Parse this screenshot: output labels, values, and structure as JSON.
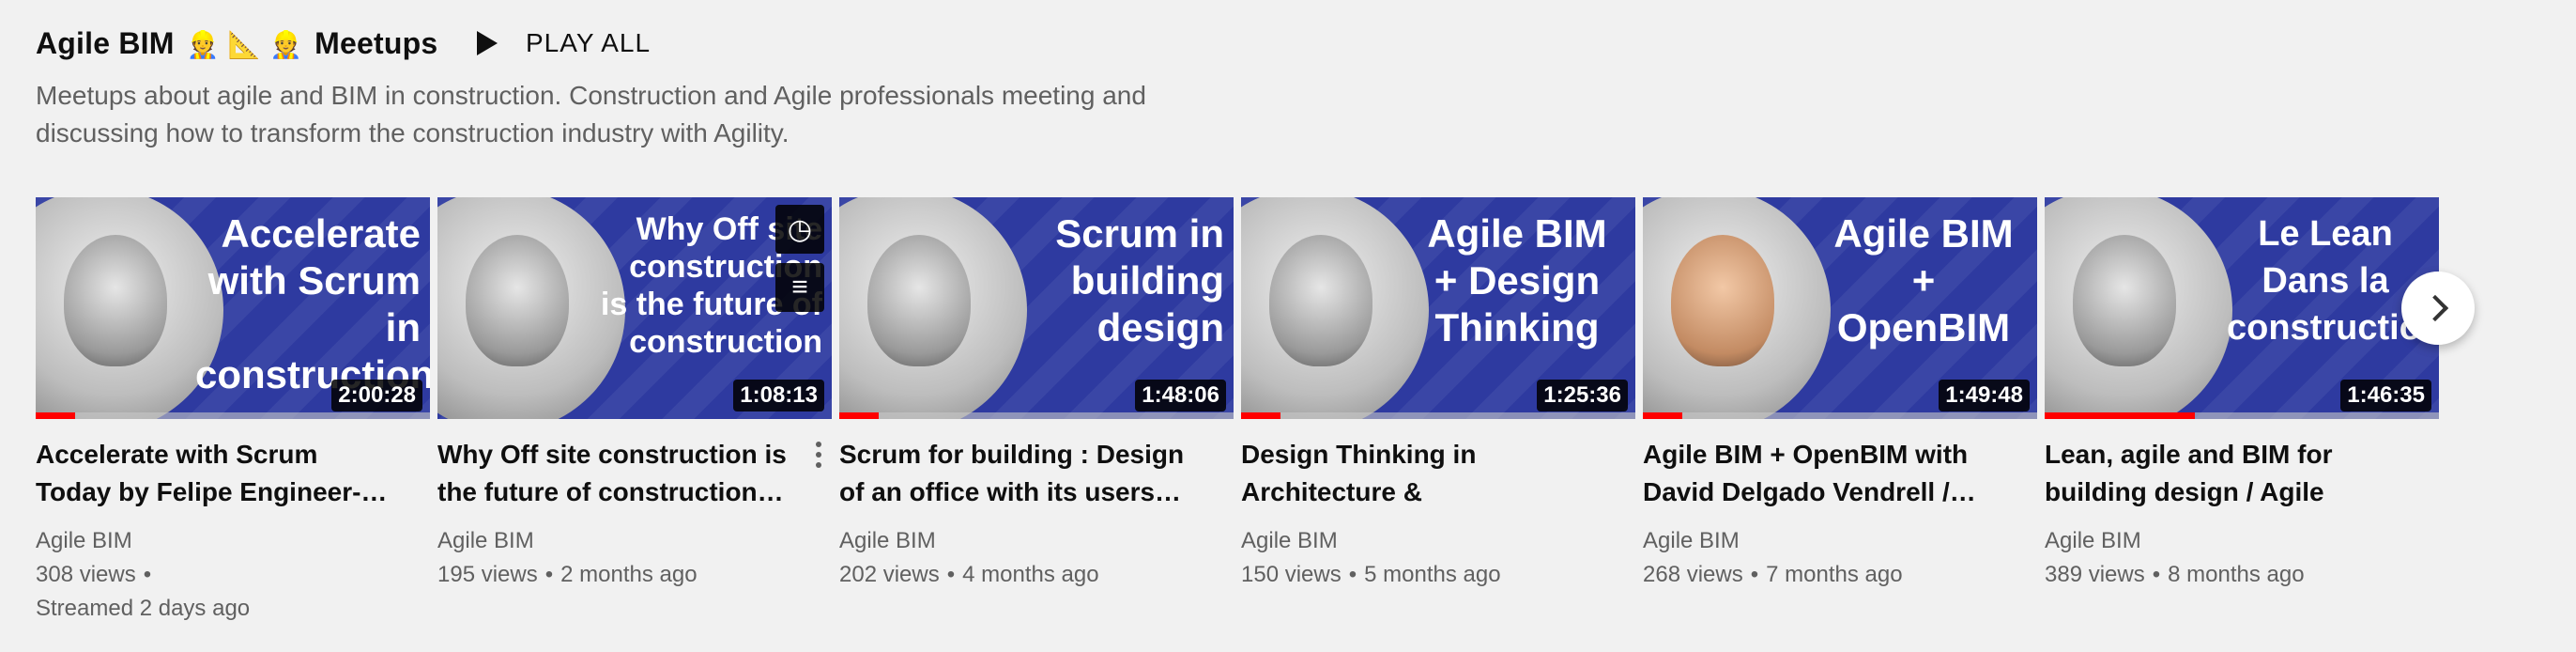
{
  "header": {
    "title_before": "Agile BIM",
    "emojis": "👷 📐 👷",
    "title_after": "Meetups",
    "play_all_label": "PLAY ALL",
    "description": "Meetups about agile and BIM in construction. Construction and Agile professionals meeting and discussing how to transform the construction industry with Agility."
  },
  "videos": [
    {
      "thumb_text": "Accelerate with Scrum in construction",
      "duration": "2:00:28",
      "progress": 0.1,
      "title": "Accelerate with Scrum Today by Felipe Engineer-…",
      "channel": "Agile BIM",
      "views": "308 views",
      "age": "",
      "extra": "Streamed 2 days ago"
    },
    {
      "thumb_text": "Why Off site construction is the future of construction",
      "duration": "1:08:13",
      "progress": 0.0,
      "title": "Why Off site construction is the future of construction…",
      "channel": "Agile BIM",
      "views": "195 views",
      "age": "2 months ago",
      "extra": ""
    },
    {
      "thumb_text": "Scrum in building design",
      "duration": "1:48:06",
      "progress": 0.1,
      "title": "Scrum for building : Design of an office with its users…",
      "channel": "Agile BIM",
      "views": "202 views",
      "age": "4 months ago",
      "extra": ""
    },
    {
      "thumb_text": "Agile BIM + Design Thinking",
      "duration": "1:25:36",
      "progress": 0.1,
      "title": "Design Thinking in Architecture & constructio…",
      "channel": "Agile BIM",
      "views": "150 views",
      "age": "5 months ago",
      "extra": ""
    },
    {
      "thumb_text": "Agile BIM + OpenBIM",
      "duration": "1:49:48",
      "progress": 0.1,
      "title": "Agile BIM + OpenBIM with David Delgado Vendrell /…",
      "channel": "Agile BIM",
      "views": "268 views",
      "age": "7 months ago",
      "extra": ""
    },
    {
      "thumb_text": "Le Lean Dans la construction",
      "duration": "1:46:35",
      "progress": 0.38,
      "title": "Lean, agile and BIM for building design / Agile BIM…",
      "channel": "Agile BIM",
      "views": "389 views",
      "age": "8 months ago",
      "extra": ""
    }
  ],
  "hover_icons": {
    "watch_later": "clock-icon",
    "add_to_queue": "queue-icon"
  },
  "colors": {
    "background": "#f1f1f1",
    "thumb_blue": "#2e3aa0",
    "progress": "#ff0000",
    "meta_gray": "#606060"
  }
}
